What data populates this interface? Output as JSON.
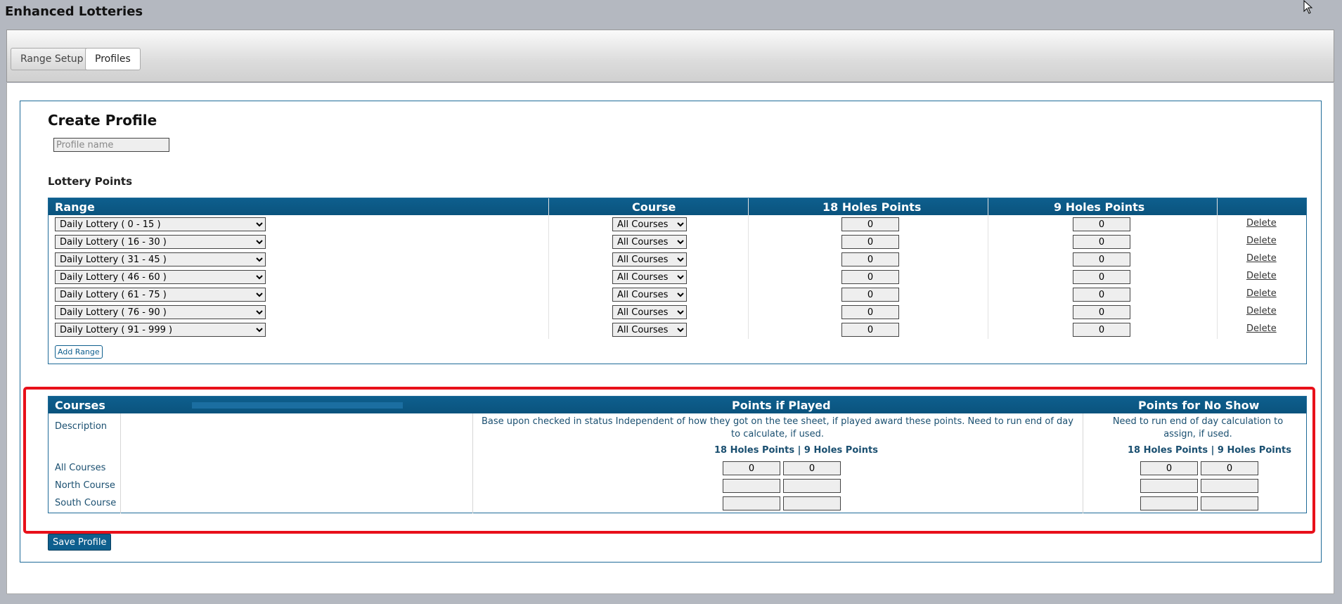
{
  "app": {
    "title": "Enhanced Lotteries"
  },
  "tabs": [
    {
      "label": "Range Setup",
      "active": false
    },
    {
      "label": "Profiles",
      "active": true
    }
  ],
  "profile": {
    "title": "Create Profile",
    "name_placeholder": "Profile name",
    "name_value": ""
  },
  "lottery_points": {
    "title": "Lottery Points",
    "headers": {
      "range": "Range",
      "course": "Course",
      "holes18": "18 Holes Points",
      "holes9": "9 Holes Points"
    },
    "rows": [
      {
        "range": "Daily Lottery ( 0 - 15 )",
        "course": "All Courses",
        "holes18": "0",
        "holes9": "0",
        "action": "Delete"
      },
      {
        "range": "Daily Lottery ( 16 - 30 )",
        "course": "All Courses",
        "holes18": "0",
        "holes9": "0",
        "action": "Delete"
      },
      {
        "range": "Daily Lottery ( 31 - 45 )",
        "course": "All Courses",
        "holes18": "0",
        "holes9": "0",
        "action": "Delete"
      },
      {
        "range": "Daily Lottery ( 46 - 60 )",
        "course": "All Courses",
        "holes18": "0",
        "holes9": "0",
        "action": "Delete"
      },
      {
        "range": "Daily Lottery ( 61 - 75 )",
        "course": "All Courses",
        "holes18": "0",
        "holes9": "0",
        "action": "Delete"
      },
      {
        "range": "Daily Lottery ( 76 - 90 )",
        "course": "All Courses",
        "holes18": "0",
        "holes9": "0",
        "action": "Delete"
      },
      {
        "range": "Daily Lottery ( 91 - 999 )",
        "course": "All Courses",
        "holes18": "0",
        "holes9": "0",
        "action": "Delete"
      }
    ],
    "add_range_label": "Add Range"
  },
  "courses": {
    "headers": {
      "courses": "Courses",
      "played": "Points if Played",
      "noshow": "Points for No Show"
    },
    "description_label": "Description",
    "played_description": "Base upon checked in status Independent of how they got on the tee sheet, if played award these points. Need to run end of day to calculate, if used.",
    "noshow_description": "Need to run end of day calculation to assign, if used.",
    "played_subhead": "18 Holes Points | 9 Holes Points",
    "noshow_subhead": "18 Holes Points | 9 Holes Points",
    "rows": [
      {
        "name": "All Courses",
        "played18": "0",
        "played9": "0",
        "noshow18": "0",
        "noshow9": "0"
      },
      {
        "name": "North Course",
        "played18": "",
        "played9": "",
        "noshow18": "",
        "noshow9": ""
      },
      {
        "name": "South Course",
        "played18": "",
        "played9": "",
        "noshow18": "",
        "noshow9": ""
      }
    ]
  },
  "save_label": "Save Profile",
  "colors": {
    "header_bg": "#0e5f8e",
    "highlight": "#e8101a"
  }
}
